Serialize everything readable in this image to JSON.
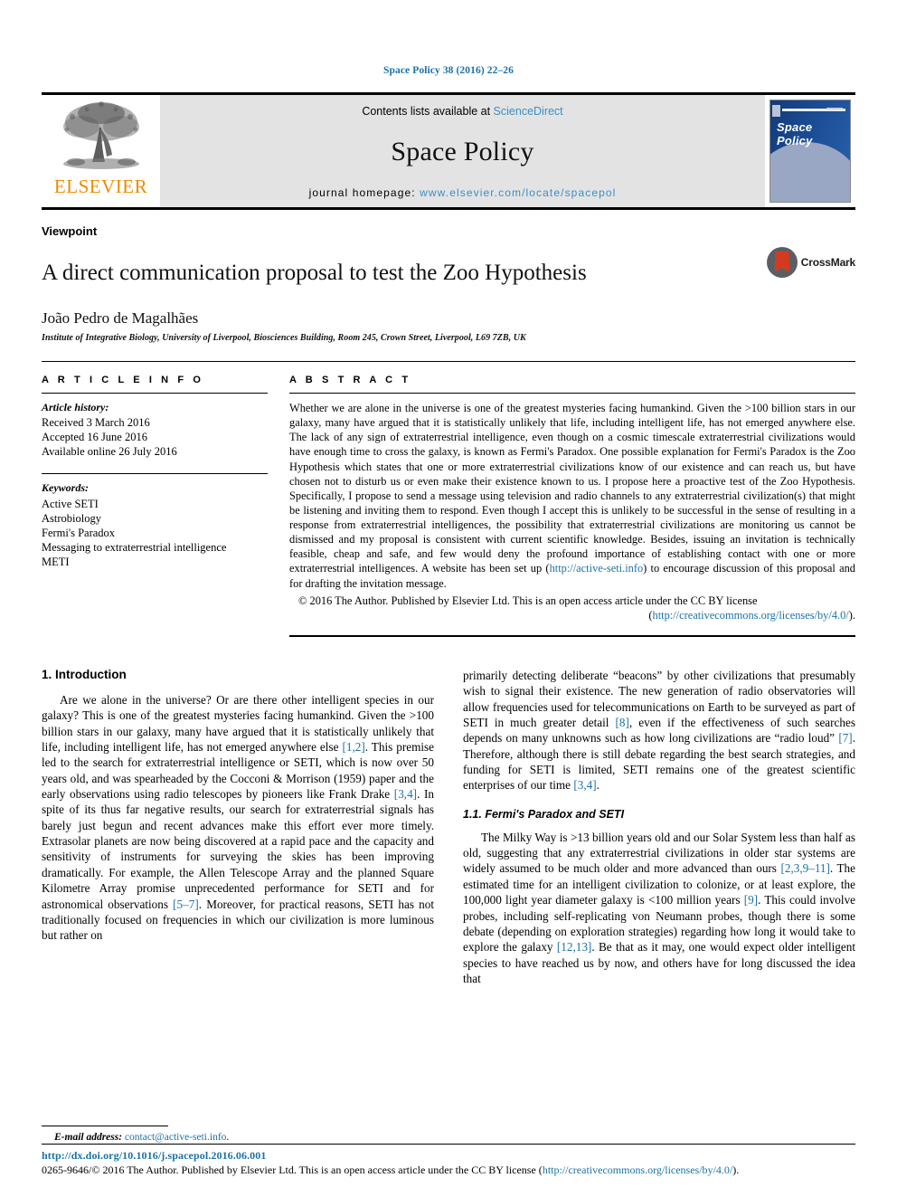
{
  "running_head": "Space Policy 38 (2016) 22–26",
  "masthead": {
    "publisher": "ELSEVIER",
    "publisher_logo": "elsevier-tree-logo",
    "contents_prefix": "Contents lists available at ",
    "contents_link": "ScienceDirect",
    "journal_title": "Space Policy",
    "homepage_prefix": "journal homepage: ",
    "homepage_url": "www.elsevier.com/locate/spacepol",
    "cover_title": "Space Policy"
  },
  "article": {
    "type": "Viewpoint",
    "title": "A direct communication proposal to test the Zoo Hypothesis",
    "author": "João Pedro de Magalhães",
    "affiliation": "Institute of Integrative Biology, University of Liverpool, Biosciences Building, Room 245, Crown Street, Liverpool, L69 7ZB, UK",
    "crossmark_label": "CrossMark"
  },
  "article_info": {
    "heading": "A R T I C L E  I N F O",
    "history_label": "Article history:",
    "history": [
      "Received 3 March 2016",
      "Accepted 16 June 2016",
      "Available online 26 July 2016"
    ],
    "keywords_label": "Keywords:",
    "keywords": [
      "Active SETI",
      "Astrobiology",
      "Fermi's Paradox",
      "Messaging to extraterrestrial intelligence",
      "METI"
    ]
  },
  "abstract": {
    "heading": "A B S T R A C T",
    "text_before_link": "Whether we are alone in the universe is one of the greatest mysteries facing humankind. Given the >100 billion stars in our galaxy, many have argued that it is statistically unlikely that life, including intelligent life, has not emerged anywhere else. The lack of any sign of extraterrestrial intelligence, even though on a cosmic timescale extraterrestrial civilizations would have enough time to cross the galaxy, is known as Fermi's Paradox. One possible explanation for Fermi's Paradox is the Zoo Hypothesis which states that one or more extraterrestrial civilizations know of our existence and can reach us, but have chosen not to disturb us or even make their existence known to us. I propose here a proactive test of the Zoo Hypothesis. Specifically, I propose to send a message using television and radio channels to any extraterrestrial civilization(s) that might be listening and inviting them to respond. Even though I accept this is unlikely to be successful in the sense of resulting in a response from extraterrestrial intelligences, the possibility that extraterrestrial civilizations are monitoring us cannot be dismissed and my proposal is consistent with current scientific knowledge. Besides, issuing an invitation is technically feasible, cheap and safe, and few would deny the profound importance of establishing contact with one or more extraterrestrial intelligences. A website has been set up (",
    "website_link": "http://active-seti.info",
    "text_after_link": ") to encourage discussion of this proposal and for drafting the invitation message.",
    "copyright_lead": "© 2016 The Author. Published by Elsevier Ltd. This is an open access article under the CC BY license",
    "license_open": "(",
    "license_link": "http://creativecommons.org/licenses/by/4.0/",
    "license_close": ").",
    "copyright_symbol": "©"
  },
  "body": {
    "left": {
      "section_heading": "1. Introduction",
      "paragraphs": [
        {
          "indent": true,
          "runs": [
            {
              "t": "Are we alone in the universe? Or are there other intelligent species in our galaxy? This is one of the greatest mysteries facing humankind. Given the >100 billion stars in our galaxy, many have argued that it is statistically unlikely that life, including intelligent life, has not emerged anywhere else ",
              "link": false
            },
            {
              "t": "[1,2]",
              "link": true
            },
            {
              "t": ". This premise led to the search for extraterrestrial intelligence or SETI, which is now over 50 years old, and was spearheaded by the Cocconi & Morrison (1959) paper and the early observations using radio telescopes by pioneers like Frank Drake ",
              "link": false
            },
            {
              "t": "[3,4]",
              "link": true
            },
            {
              "t": ". In spite of its thus far negative results, our search for extraterrestrial signals has barely just begun and recent advances make this effort ever more timely. Extrasolar planets are now being discovered at a rapid pace and the capacity and sensitivity of instruments for surveying the skies has been improving dramatically. For example, the Allen Telescope Array and the planned Square Kilometre Array promise unprecedented performance for SETI and for astronomical observations ",
              "link": false
            },
            {
              "t": "[5–7]",
              "link": true
            },
            {
              "t": ". Moreover, for practical reasons, SETI has not traditionally focused on frequencies in which our civilization is more luminous but rather on",
              "link": false
            }
          ]
        }
      ]
    },
    "right": {
      "paragraphs": [
        {
          "indent": false,
          "runs": [
            {
              "t": "primarily detecting deliberate “beacons” by other civilizations that presumably wish to signal their existence. The new generation of radio observatories will allow frequencies used for telecommunications on Earth to be surveyed as part of SETI in much greater detail ",
              "link": false
            },
            {
              "t": "[8]",
              "link": true
            },
            {
              "t": ", even if the effectiveness of such searches depends on many unknowns such as how long civilizations are “radio loud” ",
              "link": false
            },
            {
              "t": "[7]",
              "link": true
            },
            {
              "t": ". Therefore, although there is still debate regarding the best search strategies, and funding for SETI is limited, SETI remains one of the greatest scientific enterprises of our time ",
              "link": false
            },
            {
              "t": "[3,4]",
              "link": true
            },
            {
              "t": ".",
              "link": false
            }
          ]
        }
      ],
      "subsection_heading": "1.1. Fermi's Paradox and SETI",
      "paragraphs2": [
        {
          "indent": true,
          "runs": [
            {
              "t": "The Milky Way is >13 billion years old and our Solar System less than half as old, suggesting that any extraterrestrial civilizations in older star systems are widely assumed to be much older and more advanced than ours ",
              "link": false
            },
            {
              "t": "[2,3,9–11]",
              "link": true
            },
            {
              "t": ". The estimated time for an intelligent civilization to colonize, or at least explore, the 100,000 light year diameter galaxy is <100 million years ",
              "link": false
            },
            {
              "t": "[9]",
              "link": true
            },
            {
              "t": ". This could involve probes, including self-replicating von Neumann probes, though there is some debate (depending on exploration strategies) regarding how long it would take to explore the galaxy ",
              "link": false
            },
            {
              "t": "[12,13]",
              "link": true
            },
            {
              "t": ". Be that as it may, one would expect older intelligent species to have reached us by now, and others have for long discussed the idea that",
              "link": false
            }
          ]
        }
      ]
    }
  },
  "footnote": {
    "email_label": "E-mail address:",
    "email": "contact@active-seti.info",
    "email_suffix": "."
  },
  "footer": {
    "doi": "http://dx.doi.org/10.1016/j.spacepol.2016.06.001",
    "issn_prefix": "0265-9646/© 2016 The Author. Published by Elsevier Ltd. This is an open access article under the CC BY license (",
    "license_link": "http://creativecommons.org/licenses/by/4.0/",
    "issn_suffix": ")."
  },
  "colors": {
    "link": "#1a72a8",
    "elsevier_orange": "#ed8b00",
    "masthead_bg": "#e3e3e3",
    "cover_blue": "#1b4d95",
    "crossmark_red": "#d33a20"
  }
}
